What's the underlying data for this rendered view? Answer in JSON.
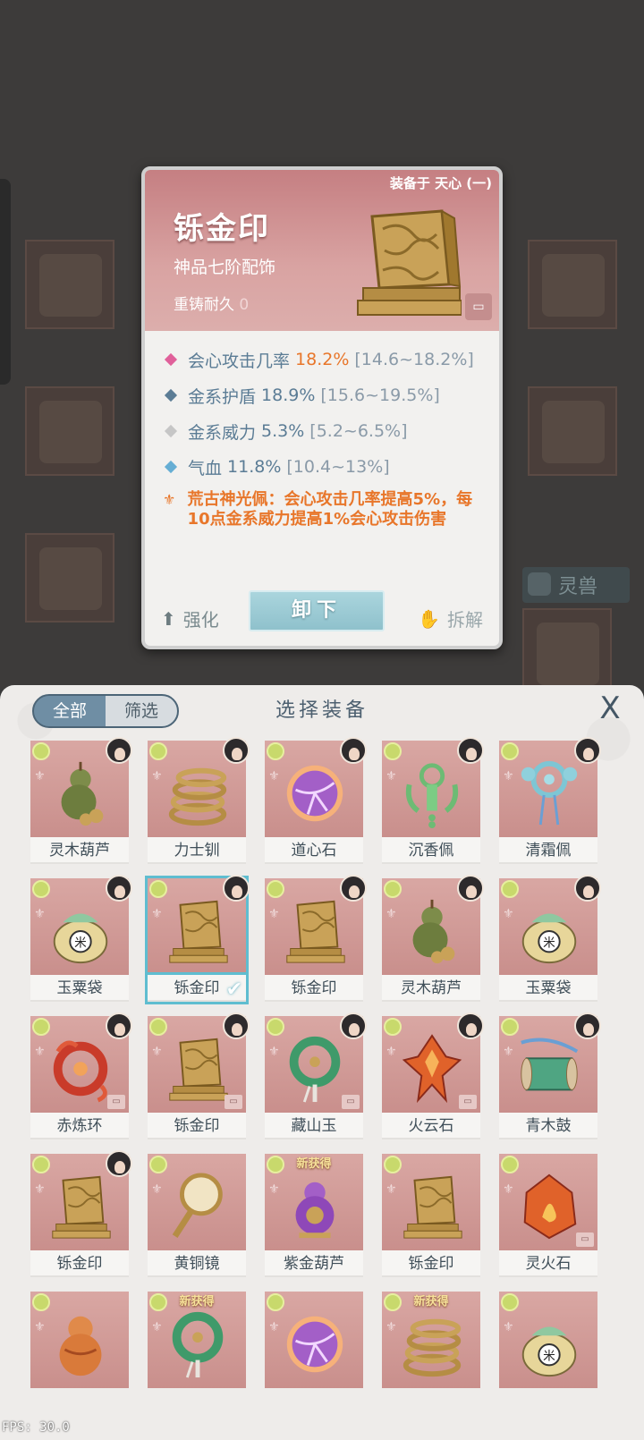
{
  "detail": {
    "equipped_by": "装备于 天心 (一)",
    "title": "铄金印",
    "grade": "神品七阶配饰",
    "durability_label": "重铸耐久",
    "durability_value": "0",
    "stats": [
      {
        "label": "会心攻击几率",
        "value": "18.2%",
        "range": "[14.6~18.2%]",
        "color": "#e0609a",
        "highlight": true
      },
      {
        "label": "金系护盾",
        "value": "18.9%",
        "range": "[15.6~19.5%]",
        "color": "#5b7c95",
        "highlight": false
      },
      {
        "label": "金系威力",
        "value": "5.3%",
        "range": "[5.2~6.5%]",
        "color": "#c6c6c6",
        "highlight": false
      },
      {
        "label": "气血",
        "value": "11.8%",
        "range": "[10.4~13%]",
        "color": "#66aed4",
        "highlight": false
      }
    ],
    "passive": "荒古神光佩：会心攻击几率提高5%，每10点金系威力提高1%会心攻击伤害",
    "strengthen_label": "强化",
    "unequip_label": "卸下",
    "dismantle_label": "拆解"
  },
  "background": {
    "beast_label": "灵兽"
  },
  "panel": {
    "filter_all": "全部",
    "filter_select": "筛选",
    "title": "选择装备",
    "close": "X"
  },
  "items": [
    {
      "name": "灵木葫芦",
      "icon": "gourd-icon",
      "avatar": true,
      "lock": false,
      "new": false,
      "selected": false
    },
    {
      "name": "力士钏",
      "icon": "bracelet-icon",
      "avatar": true,
      "lock": false,
      "new": false,
      "selected": false
    },
    {
      "name": "道心石",
      "icon": "purple-orb-icon",
      "avatar": true,
      "lock": false,
      "new": false,
      "selected": false
    },
    {
      "name": "沉香佩",
      "icon": "jade-pendant-icon",
      "avatar": true,
      "lock": false,
      "new": false,
      "selected": false
    },
    {
      "name": "清霜佩",
      "icon": "frost-pendant-icon",
      "avatar": true,
      "lock": false,
      "new": false,
      "selected": false
    },
    {
      "name": "玉粟袋",
      "icon": "pouch-icon",
      "avatar": true,
      "lock": false,
      "new": false,
      "selected": false
    },
    {
      "name": "铄金印",
      "icon": "seal-icon",
      "avatar": true,
      "lock": false,
      "new": false,
      "selected": true
    },
    {
      "name": "铄金印",
      "icon": "seal-icon",
      "avatar": true,
      "lock": false,
      "new": false,
      "selected": false
    },
    {
      "name": "灵木葫芦",
      "icon": "gourd-icon",
      "avatar": true,
      "lock": false,
      "new": false,
      "selected": false
    },
    {
      "name": "玉粟袋",
      "icon": "pouch-icon",
      "avatar": true,
      "lock": false,
      "new": false,
      "selected": false
    },
    {
      "name": "赤炼环",
      "icon": "flame-ring-icon",
      "avatar": true,
      "lock": true,
      "new": false,
      "selected": false
    },
    {
      "name": "铄金印",
      "icon": "seal-icon",
      "avatar": true,
      "lock": true,
      "new": false,
      "selected": false
    },
    {
      "name": "藏山玉",
      "icon": "jade-disc-icon",
      "avatar": true,
      "lock": true,
      "new": false,
      "selected": false
    },
    {
      "name": "火云石",
      "icon": "fire-crystal-icon",
      "avatar": true,
      "lock": true,
      "new": false,
      "selected": false
    },
    {
      "name": "青木鼓",
      "icon": "drum-icon",
      "avatar": true,
      "lock": false,
      "new": false,
      "selected": false
    },
    {
      "name": "铄金印",
      "icon": "seal-icon",
      "avatar": true,
      "lock": false,
      "new": false,
      "selected": false
    },
    {
      "name": "黄铜镜",
      "icon": "mirror-icon",
      "avatar": false,
      "lock": false,
      "new": false,
      "selected": false
    },
    {
      "name": "紫金葫芦",
      "icon": "purple-gourd-icon",
      "avatar": false,
      "lock": false,
      "new": true,
      "selected": false
    },
    {
      "name": "铄金印",
      "icon": "seal-icon",
      "avatar": false,
      "lock": false,
      "new": false,
      "selected": false
    },
    {
      "name": "灵火石",
      "icon": "fire-stone-icon",
      "avatar": false,
      "lock": true,
      "new": false,
      "selected": false
    },
    {
      "name": "",
      "icon": "orange-gourd-icon",
      "avatar": false,
      "lock": false,
      "new": false,
      "selected": false
    },
    {
      "name": "",
      "icon": "jade-disc-icon",
      "avatar": false,
      "lock": false,
      "new": true,
      "selected": false
    },
    {
      "name": "",
      "icon": "purple-orb-icon",
      "avatar": false,
      "lock": false,
      "new": false,
      "selected": false
    },
    {
      "name": "",
      "icon": "bracelet-icon",
      "avatar": false,
      "lock": false,
      "new": true,
      "selected": false
    },
    {
      "name": "",
      "icon": "pouch-icon",
      "avatar": false,
      "lock": false,
      "new": false,
      "selected": false
    }
  ],
  "new_tag": "新获得",
  "fps": "FPS: 30.0"
}
